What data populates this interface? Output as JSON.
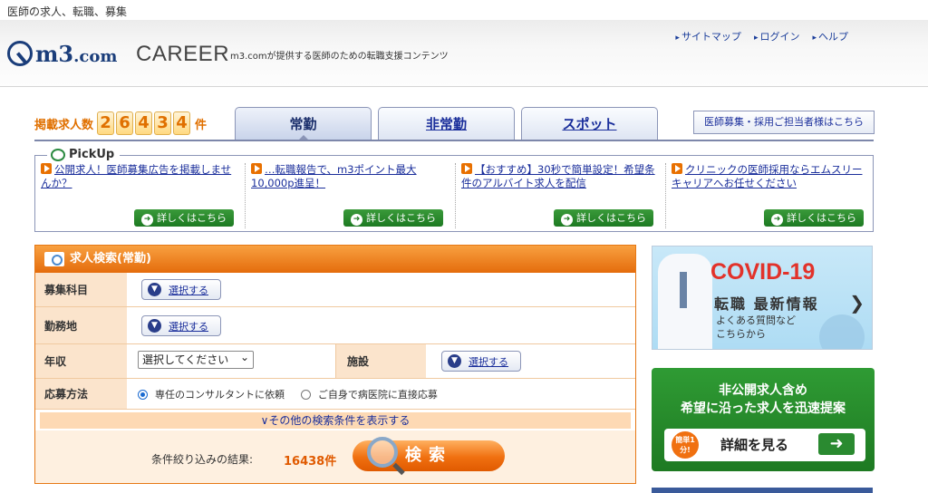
{
  "top": {
    "text": "医師の求人、転職、募集"
  },
  "header": {
    "logo_text": "m3",
    "logo_suffix": ".com",
    "career": "CAREER",
    "tagline": "m3.comが提供する医師のための転職支援コンテンツ",
    "links": [
      "サイトマップ",
      "ログイン",
      "ヘルプ"
    ]
  },
  "counter": {
    "label": "掲載求人数",
    "digits": [
      "2",
      "6",
      "4",
      "3",
      "4"
    ],
    "unit": "件"
  },
  "tabs": {
    "full_time": "常勤",
    "part_time": "非常勤",
    "spot": "スポット"
  },
  "recruit_link": "医師募集・採用ご担当者様はこちら",
  "pickup": {
    "title": "PickUp",
    "items": [
      {
        "text": "公開求人！医師募集広告を掲載しませんか？",
        "button": "詳しくはこちら"
      },
      {
        "text": "…転職報告で、m3ポイント最大10,000p進呈！",
        "button": "詳しくはこちら"
      },
      {
        "text": "【おすすめ】30秒で簡単設定！希望条件のアルバイト求人を配信",
        "button": "詳しくはこちら"
      },
      {
        "text": "クリニックの医師採用ならエムスリーキャリアへお任せください",
        "button": "詳しくはこちら"
      }
    ]
  },
  "search": {
    "title": "求人検索(常勤)",
    "rows": {
      "dept": "募集科目",
      "location": "勤務地",
      "salary": "年収",
      "facility": "施設",
      "method": "応募方法"
    },
    "select_label": "選択する",
    "salary_value": "選択してください",
    "radio_consultant": "専任のコンサルタントに依頼",
    "radio_direct": "ご自身で病医院に直接応募",
    "more": "その他の検索条件を表示する",
    "result_label": "条件絞り込みの結果:",
    "result_count": "16438件",
    "search_button": "検索"
  },
  "covid": {
    "title": "COVID-19",
    "subtitle": "転職 最新情報",
    "line1": "よくある質問など",
    "line2": "こちらから"
  },
  "green": {
    "line1": "非公開求人含め",
    "line2": "希望に沿った求人を迅速提案",
    "badge": "簡単1分!",
    "button": "詳細を見る"
  }
}
